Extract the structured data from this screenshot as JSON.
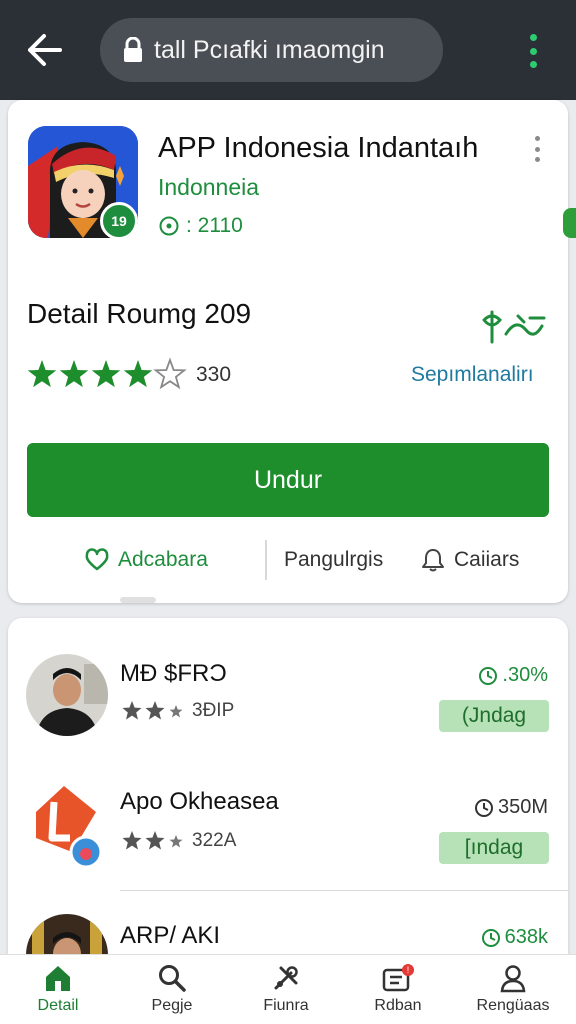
{
  "browser": {
    "url_text": "tall Pcıafki ımaomgin"
  },
  "app": {
    "title": "APP Indonesia Indantaıh",
    "developer": "Indonneia",
    "meta": ": 2110",
    "badge": "19"
  },
  "detail": {
    "title": "Detail Roumg 209",
    "rating_value": 4,
    "rating_max": 5,
    "rating_count": "330",
    "rating_link": "Sepımlanalirı"
  },
  "install_label": "Undur",
  "actions": [
    {
      "label": "Adcabara"
    },
    {
      "label": "Pangulrgis"
    },
    {
      "label": "Caiiars"
    }
  ],
  "list": [
    {
      "name": "MÐ $FRƆ",
      "rating": "3ÐIP",
      "size": ".30%",
      "button": "(Jndag"
    },
    {
      "name": "Apo Okheasea",
      "rating": "322A",
      "size": "350M",
      "button": "[ındag"
    },
    {
      "name": "ARP/ AKI",
      "size": "638k"
    }
  ],
  "nav": [
    {
      "label": "Detail"
    },
    {
      "label": "Pegje"
    },
    {
      "label": "Fiunra"
    },
    {
      "label": "Rdban"
    },
    {
      "label": "Rengüaas"
    }
  ],
  "colors": {
    "accent": "#1e8e2c",
    "topbar": "#2b3036",
    "link": "#1f7a9e"
  }
}
